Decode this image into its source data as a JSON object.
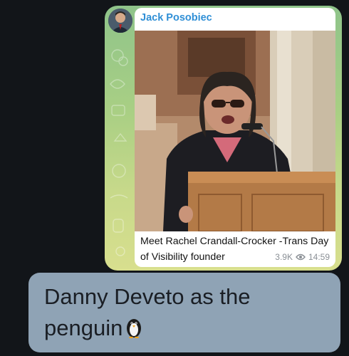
{
  "message": {
    "sender": "Jack Posobiec",
    "caption": "Meet Rachel Crandall-Crocker -Trans Day of Visibility founder",
    "views": "3.9K",
    "time": "14:59",
    "icons": [
      "avatar",
      "eye-icon"
    ]
  },
  "reply": {
    "text": "Danny Deveto as the penguin",
    "emoji_icon": "penguin-emoji-icon"
  },
  "colors": {
    "background": "#121519",
    "sender_name": "#2f8fd6",
    "reply_bubble": "#8fa3b5"
  }
}
